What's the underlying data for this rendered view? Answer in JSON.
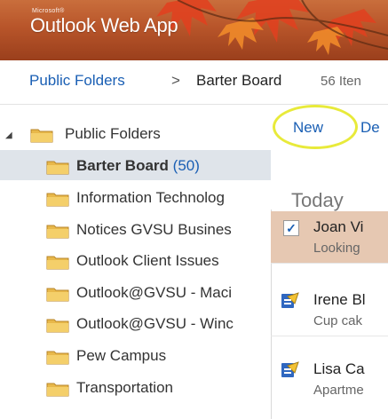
{
  "app": {
    "brand_small": "Microsoft®",
    "title": "Outlook Web App"
  },
  "breadcrumb": {
    "root": "Public Folders",
    "separator": ">",
    "current": "Barter Board",
    "count": "56 Iten"
  },
  "toolbar": {
    "new_label": "New",
    "delete_label_partial": "De"
  },
  "folders": [
    {
      "label": "Public Folders",
      "expanded": true,
      "icon": "folder-icon"
    },
    {
      "label": "Barter Board",
      "count": "(50)",
      "selected": true,
      "icon": "folder-icon"
    },
    {
      "label": "Information Technolog",
      "icon": "folder-icon"
    },
    {
      "label": "Notices GVSU Busines",
      "icon": "folder-icon"
    },
    {
      "label": "Outlook Client Issues",
      "icon": "folder-icon"
    },
    {
      "label": "Outlook@GVSU - Maci",
      "icon": "folder-icon"
    },
    {
      "label": "Outlook@GVSU - Winc",
      "icon": "folder-icon"
    },
    {
      "label": "Pew Campus",
      "icon": "folder-icon"
    },
    {
      "label": "Transportation",
      "icon": "folder-icon"
    }
  ],
  "messages": {
    "group_label": "Today",
    "items": [
      {
        "from": "Joan Vi",
        "preview": "Looking",
        "selected": true,
        "icon": "checkbox-checked-icon"
      },
      {
        "from": "Irene Bl",
        "preview": "Cup cak",
        "icon": "post-item-icon"
      },
      {
        "from": "Lisa Ca",
        "preview": "Apartme",
        "icon": "post-item-icon"
      }
    ]
  },
  "colors": {
    "banner": "#b8552a",
    "link": "#1a5fb4",
    "selected_folder_bg": "#dfe4ea",
    "selected_message_bg": "#e6c8b2",
    "highlight_ring": "#e8ea3a"
  }
}
